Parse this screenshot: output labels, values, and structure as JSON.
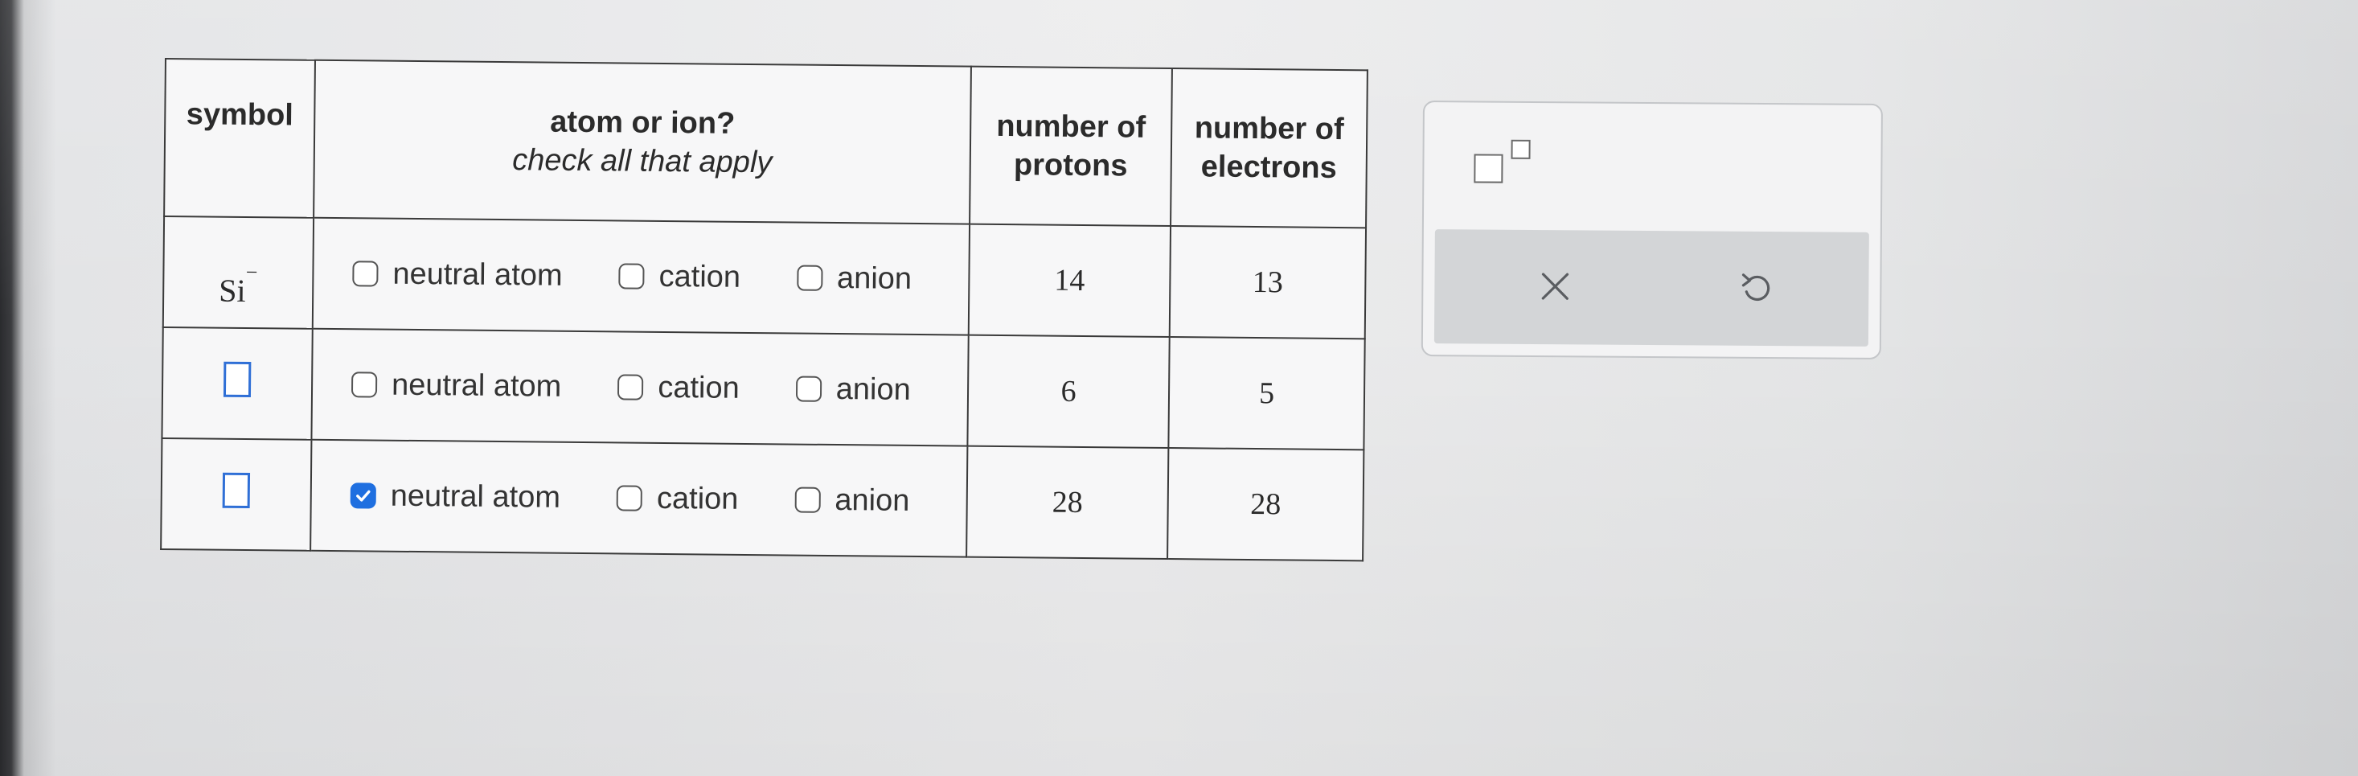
{
  "table": {
    "headers": {
      "symbol": "symbol",
      "atom_or_ion": "atom or ion?",
      "atom_or_ion_sub": "check all that apply",
      "protons": "number of protons",
      "electrons": "number of electrons"
    },
    "rows": [
      {
        "symbol_element": "Si",
        "symbol_charge": "−",
        "options": [
          {
            "label": "neutral atom",
            "checked": false
          },
          {
            "label": "cation",
            "checked": false
          },
          {
            "label": "anion",
            "checked": false
          }
        ],
        "protons": "14",
        "electrons": "13"
      },
      {
        "symbol_element": "",
        "symbol_charge": "",
        "options": [
          {
            "label": "neutral atom",
            "checked": false
          },
          {
            "label": "cation",
            "checked": false
          },
          {
            "label": "anion",
            "checked": false
          }
        ],
        "protons": "6",
        "electrons": "5"
      },
      {
        "symbol_element": "",
        "symbol_charge": "",
        "options": [
          {
            "label": "neutral atom",
            "checked": true
          },
          {
            "label": "cation",
            "checked": false
          },
          {
            "label": "anion",
            "checked": false
          }
        ],
        "protons": "28",
        "electrons": "28"
      }
    ]
  },
  "tools": {
    "superscript_icon": "superscript-box-icon",
    "clear_icon": "x-icon",
    "undo_icon": "undo-icon"
  },
  "colors": {
    "checkbox_checked": "#1f6fe0",
    "input_box_border": "#2f6fd6",
    "table_border": "#3a3a3a",
    "tool_icon": "#5a5d61"
  }
}
